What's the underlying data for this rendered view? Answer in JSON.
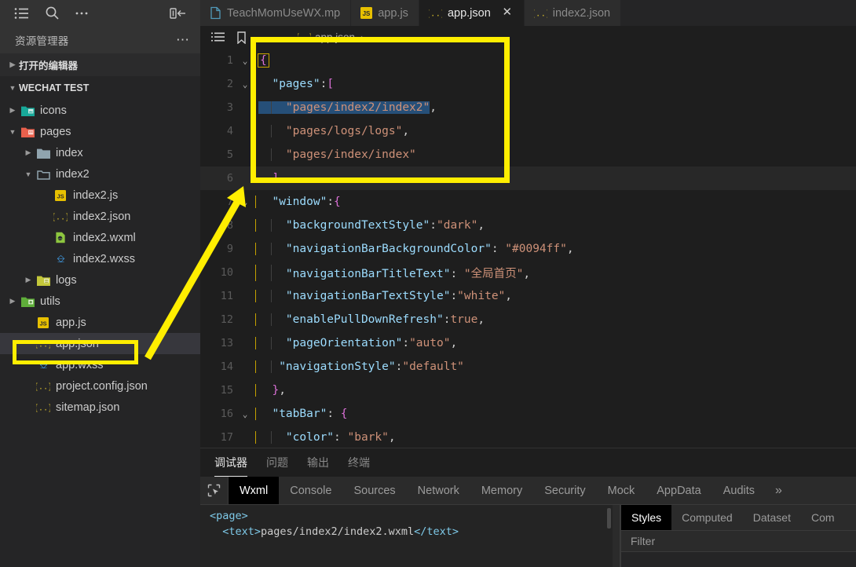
{
  "toolbar": {
    "menu_icon": "menu-icon",
    "search_icon": "search-icon",
    "more_icon": "more-icon",
    "toggle_sidebar_icon": "toggle-sidebar-icon"
  },
  "tabs": [
    {
      "label": "TeachMomUseWX.mp",
      "icon": "file-icon",
      "icon_type": "plain",
      "active": false,
      "closable": false
    },
    {
      "label": "app.js",
      "icon": "js-file-icon",
      "icon_type": "js",
      "active": false,
      "closable": false
    },
    {
      "label": "app.json",
      "icon": "json-file-icon",
      "icon_type": "json",
      "active": true,
      "closable": true,
      "close_label": "✕"
    },
    {
      "label": "index2.json",
      "icon": "json-file-icon",
      "icon_type": "json",
      "active": false,
      "closable": false
    }
  ],
  "sidebar": {
    "header_title": "资源管理器",
    "header_more": "⋯",
    "sections": [
      {
        "label": "打开的编辑器",
        "expanded": false
      },
      {
        "label": "WECHAT TEST",
        "expanded": true
      }
    ],
    "tree": [
      {
        "label": "icons",
        "depth": 1,
        "type": "folder",
        "icon": "folder-icons-icon",
        "expanded": false,
        "selected": false
      },
      {
        "label": "pages",
        "depth": 1,
        "type": "folder",
        "icon": "folder-pages-icon",
        "expanded": true,
        "selected": false
      },
      {
        "label": "index",
        "depth": 2,
        "type": "folder",
        "icon": "folder-icon",
        "expanded": false,
        "selected": false
      },
      {
        "label": "index2",
        "depth": 2,
        "type": "folder",
        "icon": "folder-open-icon",
        "expanded": true,
        "selected": false
      },
      {
        "label": "index2.js",
        "depth": 3,
        "type": "file",
        "icon": "js-file-icon",
        "selected": false
      },
      {
        "label": "index2.json",
        "depth": 3,
        "type": "file",
        "icon": "json-file-icon",
        "selected": false
      },
      {
        "label": "index2.wxml",
        "depth": 3,
        "type": "file",
        "icon": "wxml-file-icon",
        "selected": false
      },
      {
        "label": "index2.wxss",
        "depth": 3,
        "type": "file",
        "icon": "wxss-file-icon",
        "selected": false
      },
      {
        "label": "logs",
        "depth": 2,
        "type": "folder",
        "icon": "folder-logs-icon",
        "expanded": false,
        "selected": false
      },
      {
        "label": "utils",
        "depth": 1,
        "type": "folder",
        "icon": "folder-utils-icon",
        "expanded": false,
        "selected": false
      },
      {
        "label": "app.js",
        "depth": 2,
        "type": "file",
        "icon": "js-file-icon",
        "selected": false
      },
      {
        "label": "app.json",
        "depth": 2,
        "type": "file",
        "icon": "json-file-icon",
        "selected": true
      },
      {
        "label": "app.wxss",
        "depth": 2,
        "type": "file",
        "icon": "wxss-file-icon",
        "selected": false
      },
      {
        "label": "project.config.json",
        "depth": 2,
        "type": "file",
        "icon": "json-file-icon",
        "selected": false
      },
      {
        "label": "sitemap.json",
        "depth": 2,
        "type": "file",
        "icon": "json-file-icon",
        "selected": false
      }
    ]
  },
  "breadcrumb": {
    "list_icon": "outline-list-icon",
    "bookmark_icon": "bookmark-icon",
    "back_icon": "arrow-left-icon",
    "forward_icon": "arrow-right-icon",
    "file": "app.json",
    "separator": "›"
  },
  "editor": {
    "file": "app.json",
    "lines": [
      {
        "n": 1,
        "fold": "⌄",
        "current": false,
        "indent": 0,
        "tokens": [
          {
            "t": "{",
            "c": "brace-cursor"
          }
        ]
      },
      {
        "n": 2,
        "fold": "⌄",
        "current": false,
        "indent": 1,
        "tokens": [
          {
            "t": "  \"pages\"",
            "c": "key"
          },
          {
            "t": ":",
            "c": "punc"
          },
          {
            "t": "[",
            "c": "brace"
          }
        ]
      },
      {
        "n": 3,
        "fold": "",
        "current": false,
        "indent": 2,
        "tokens": [
          {
            "t": "    \"pages/index2/index2\"",
            "c": "str-sel"
          },
          {
            "t": ",",
            "c": "punc"
          }
        ]
      },
      {
        "n": 4,
        "fold": "",
        "current": false,
        "indent": 2,
        "tokens": [
          {
            "t": "    \"pages/logs/logs\"",
            "c": "str"
          },
          {
            "t": ",",
            "c": "punc"
          }
        ]
      },
      {
        "n": 5,
        "fold": "",
        "current": false,
        "indent": 2,
        "tokens": [
          {
            "t": "    \"pages/index/index\"",
            "c": "str"
          }
        ]
      },
      {
        "n": 6,
        "fold": "",
        "current": true,
        "indent": 1,
        "tokens": [
          {
            "t": "  ]",
            "c": "brace"
          },
          {
            "t": ",",
            "c": "punc"
          }
        ]
      },
      {
        "n": 7,
        "fold": "⌄",
        "current": false,
        "indent": 1,
        "tokens": [
          {
            "t": "  \"window\"",
            "c": "key"
          },
          {
            "t": ":",
            "c": "punc"
          },
          {
            "t": "{",
            "c": "brace"
          }
        ]
      },
      {
        "n": 8,
        "fold": "",
        "current": false,
        "indent": 2,
        "tokens": [
          {
            "t": "    \"backgroundTextStyle\"",
            "c": "key"
          },
          {
            "t": ":",
            "c": "punc"
          },
          {
            "t": "\"dark\"",
            "c": "str"
          },
          {
            "t": ",",
            "c": "punc"
          }
        ]
      },
      {
        "n": 9,
        "fold": "",
        "current": false,
        "indent": 2,
        "tokens": [
          {
            "t": "    \"navigationBarBackgroundColor\"",
            "c": "key"
          },
          {
            "t": ": ",
            "c": "punc"
          },
          {
            "t": "\"#0094ff\"",
            "c": "str"
          },
          {
            "t": ",",
            "c": "punc"
          }
        ]
      },
      {
        "n": 10,
        "fold": "",
        "current": false,
        "indent": 2,
        "tokens": [
          {
            "t": "    \"navigationBarTitleText\"",
            "c": "key"
          },
          {
            "t": ": ",
            "c": "punc"
          },
          {
            "t": "\"全局首页\"",
            "c": "str"
          },
          {
            "t": ",",
            "c": "punc"
          }
        ]
      },
      {
        "n": 11,
        "fold": "",
        "current": false,
        "indent": 2,
        "tokens": [
          {
            "t": "    \"navigationBarTextStyle\"",
            "c": "key"
          },
          {
            "t": ":",
            "c": "punc"
          },
          {
            "t": "\"white\"",
            "c": "str"
          },
          {
            "t": ",",
            "c": "punc"
          }
        ]
      },
      {
        "n": 12,
        "fold": "",
        "current": false,
        "indent": 2,
        "tokens": [
          {
            "t": "    \"enablePullDownRefresh\"",
            "c": "key"
          },
          {
            "t": ":",
            "c": "punc"
          },
          {
            "t": "true",
            "c": "bool"
          },
          {
            "t": ",",
            "c": "punc"
          }
        ]
      },
      {
        "n": 13,
        "fold": "",
        "current": false,
        "indent": 2,
        "tokens": [
          {
            "t": "    \"pageOrientation\"",
            "c": "key"
          },
          {
            "t": ":",
            "c": "punc"
          },
          {
            "t": "\"auto\"",
            "c": "str"
          },
          {
            "t": ",",
            "c": "punc"
          }
        ]
      },
      {
        "n": 14,
        "fold": "",
        "current": false,
        "indent": 2,
        "tokens": [
          {
            "t": "   \"navigationStyle\"",
            "c": "key"
          },
          {
            "t": ":",
            "c": "punc"
          },
          {
            "t": "\"default\"",
            "c": "str"
          }
        ]
      },
      {
        "n": 15,
        "fold": "",
        "current": false,
        "indent": 1,
        "tokens": [
          {
            "t": "  }",
            "c": "brace"
          },
          {
            "t": ",",
            "c": "punc"
          }
        ]
      },
      {
        "n": 16,
        "fold": "⌄",
        "current": false,
        "indent": 1,
        "tokens": [
          {
            "t": "  \"tabBar\"",
            "c": "key"
          },
          {
            "t": ": ",
            "c": "punc"
          },
          {
            "t": "{",
            "c": "brace"
          }
        ]
      },
      {
        "n": 17,
        "fold": "",
        "current": false,
        "indent": 2,
        "tokens": [
          {
            "t": "    \"color\"",
            "c": "key"
          },
          {
            "t": ": ",
            "c": "punc"
          },
          {
            "t": "\"bark\"",
            "c": "str"
          },
          {
            "t": ",",
            "c": "punc"
          }
        ]
      }
    ]
  },
  "panel": {
    "tabs": [
      {
        "label": "调试器",
        "active": true
      },
      {
        "label": "问题",
        "active": false
      },
      {
        "label": "输出",
        "active": false
      },
      {
        "label": "终端",
        "active": false
      }
    ],
    "devtools": {
      "inspect_icon": "inspect-element-icon",
      "tabs": [
        {
          "label": "Wxml",
          "active": true
        },
        {
          "label": "Console",
          "active": false
        },
        {
          "label": "Sources",
          "active": false
        },
        {
          "label": "Network",
          "active": false
        },
        {
          "label": "Memory",
          "active": false
        },
        {
          "label": "Security",
          "active": false
        },
        {
          "label": "Mock",
          "active": false
        },
        {
          "label": "AppData",
          "active": false
        },
        {
          "label": "Audits",
          "active": false
        },
        {
          "label": "»",
          "active": false,
          "more": true
        }
      ],
      "tree_lines": [
        [
          {
            "t": "<page>",
            "c": "tag"
          }
        ],
        [
          {
            "t": "  ",
            "c": "plain"
          },
          {
            "t": "<text>",
            "c": "tag"
          },
          {
            "t": "pages/index2/index2.wxml",
            "c": "plain"
          },
          {
            "t": "</text>",
            "c": "tag"
          }
        ]
      ],
      "right_tabs": [
        {
          "label": "Styles",
          "active": true
        },
        {
          "label": "Computed",
          "active": false
        },
        {
          "label": "Dataset",
          "active": false
        },
        {
          "label": "Com",
          "active": false
        }
      ],
      "filter_placeholder": "Filter"
    }
  },
  "annotations": {
    "highlight_color": "#ffee00",
    "code_box_label": "pages-array-highlight",
    "file_box_label": "app-json-file-highlight",
    "arrow_label": "pointer-arrow"
  }
}
